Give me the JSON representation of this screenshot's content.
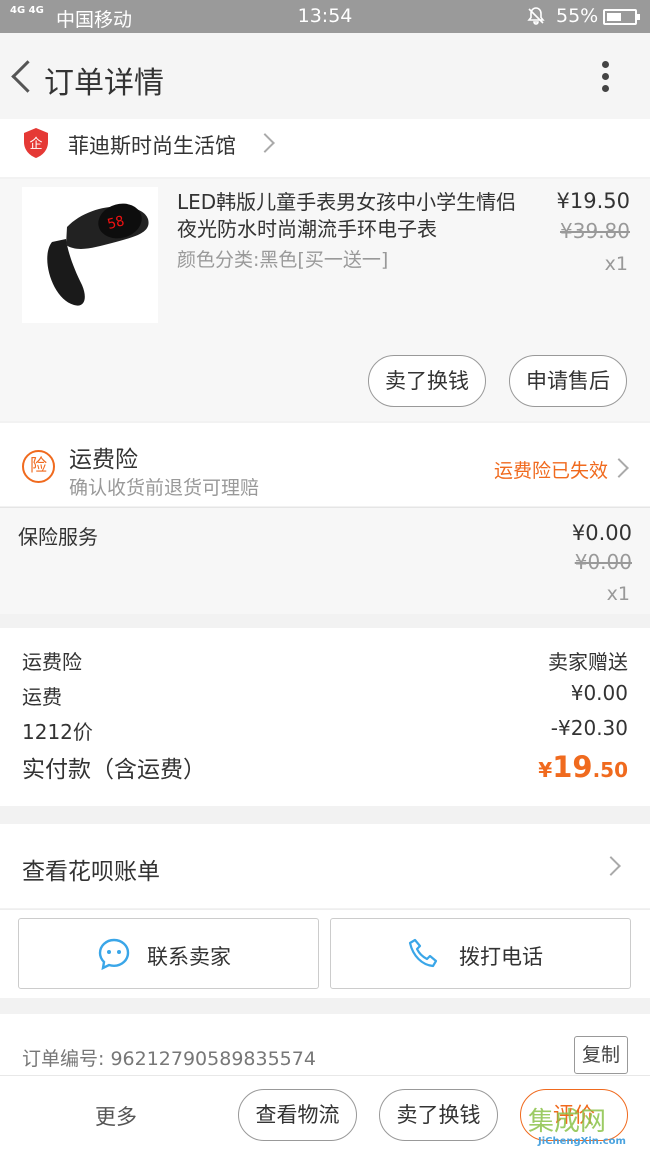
{
  "status_bar": {
    "signal": "4G 4G",
    "carrier": "中国移动",
    "time": "13:54",
    "battery": "55%",
    "battery_level": 0.55
  },
  "header": {
    "title": "订单详情"
  },
  "shop": {
    "name": "菲迪斯时尚生活馆",
    "logo_text": "企"
  },
  "product": {
    "name": "LED韩版儿童手表男女孩中小学生情侣夜光防水时尚潮流手环电子表",
    "spec": "颜色分类:黑色[买一送一]",
    "price": "¥19.50",
    "original_price": "¥39.80",
    "quantity": "x1",
    "watch_display": "58"
  },
  "product_actions": {
    "sell_label": "卖了换钱",
    "after_sale_label": "申请售后"
  },
  "insurance": {
    "icon_text": "险",
    "title": "运费险",
    "subtitle": "确认收货前退货可理赔",
    "status": "运费险已失效"
  },
  "service": {
    "label": "保险服务",
    "price": "¥0.00",
    "original_price": "¥0.00",
    "quantity": "x1"
  },
  "summary": {
    "rows": [
      {
        "key": "运费险",
        "value": "卖家赠送"
      },
      {
        "key": "运费",
        "value": "¥0.00"
      },
      {
        "key": "1212价",
        "value": "-¥20.30"
      }
    ],
    "total_label": "实付款（含运费）",
    "total_currency": "¥",
    "total_int": "19",
    "total_dec": ".50"
  },
  "huabei": {
    "label": "查看花呗账单"
  },
  "contact": {
    "seller_label": "联系卖家",
    "call_label": "拨打电话"
  },
  "order": {
    "number": "订单编号: 96212790589835574",
    "copy_label": "复制"
  },
  "bottom_bar": {
    "more_label": "更多",
    "logistics_label": "查看物流",
    "sell_label": "卖了换钱",
    "rate_label": "评价"
  },
  "watermark": {
    "top": "集成网",
    "bottom": "JiChengXin.com"
  },
  "colors": {
    "accent": "#f06a1e",
    "shield": "#e53935",
    "link_blue": "#3aa6e8"
  }
}
